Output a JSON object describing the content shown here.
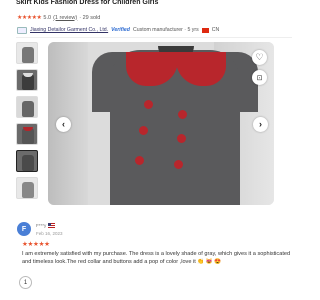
{
  "product": {
    "title": "Skirt Kids Fashion Dress for Children Girls",
    "rating": "5.0",
    "reviews_link": "(1 review)",
    "sold": "· 29 sold",
    "supplier_name": "Jiaxing Detailor Garment Co., Ltd.",
    "verified_label": "Verified",
    "supplier_type": "Custom manufacturer · 5 yrs",
    "supplier_country": "CN"
  },
  "gallery": {
    "prev_label": "‹",
    "next_label": "›",
    "favorite_icon": "heart-icon",
    "scan_icon": "scan-icon",
    "thumb_count": 6,
    "selected_thumb": 5
  },
  "review": {
    "avatar_letter": "F",
    "reviewer": "F***y",
    "reviewer_country": "US",
    "date": "Feb 16, 2023",
    "stars": "★★★★★",
    "text": "I am extremely satisfied with my purchase. The dress is a lovely shade of gray, which gives it a sophisticated and timeless look.The red collar and buttons add a pop of color ,love it 👏 😻 😍"
  },
  "pagination": {
    "current_page": "1"
  },
  "colors": {
    "accent": "#e8542f",
    "verified": "#2d6bd1",
    "collar_red": "#b8262c",
    "dress_gray": "#5a5a5c"
  }
}
